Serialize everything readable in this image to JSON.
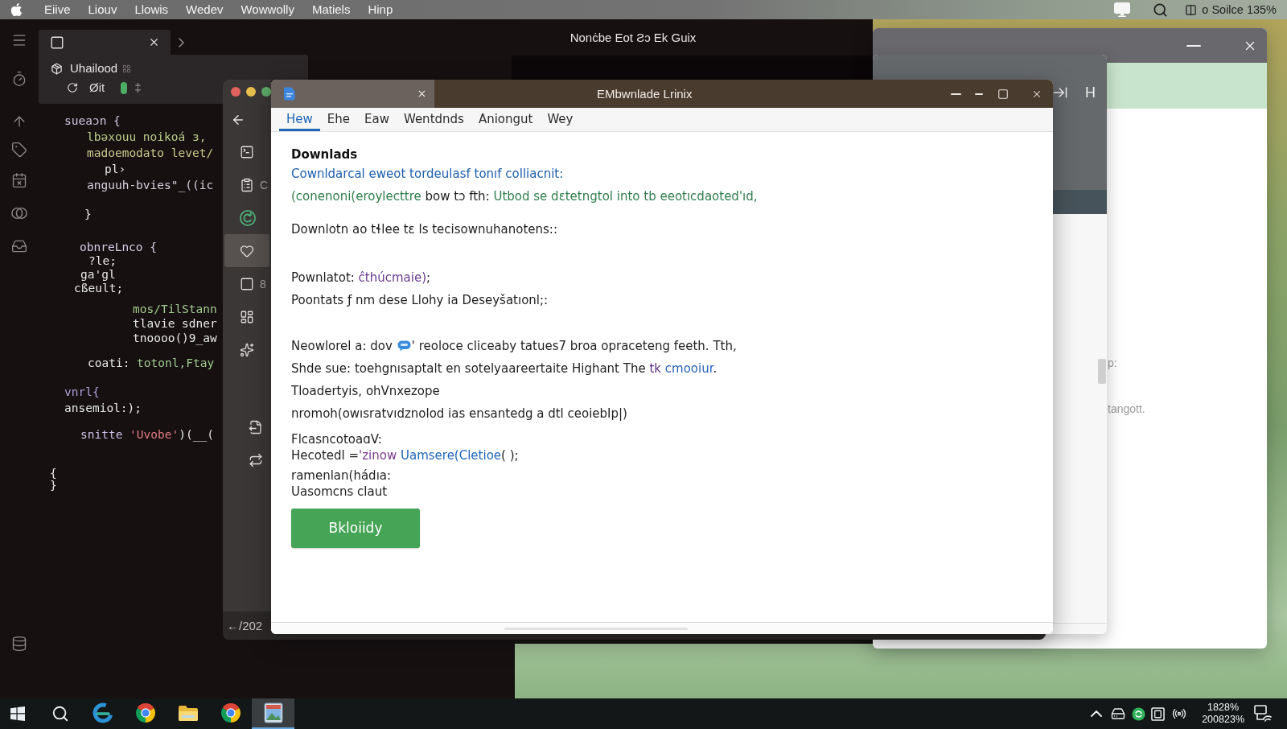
{
  "menu_bar": {
    "items": [
      "Eiive",
      "Liouv",
      "Llowis",
      "Wedev",
      "Wowwolly",
      "Matiels",
      "Hinp"
    ],
    "status_text": "o Soilce 135%"
  },
  "editor": {
    "tab_panel": {
      "title": "Uhailood",
      "branch": "Øit",
      "marker": "‡"
    },
    "code_blocks": [
      {
        "lines": [
          {
            "segments": [
              {
                "text": "sueaɔn {",
                "color": "#cdc8de"
              }
            ]
          },
          {
            "segments": [
              {
                "text": "lbəxouu noikoá ɜ,",
                "color": "#bccb8a"
              }
            ]
          },
          {
            "segments": [
              {
                "text": "madoemodato levet/",
                "color": "#c8c98c"
              }
            ]
          },
          {
            "segments": [
              {
                "text": "pl›",
                "color": "#e6e6e6"
              }
            ]
          },
          {
            "segments": [
              {
                "text": "anguuh-bvies\"_((ic",
                "color": "#d6d2dc"
              }
            ]
          }
        ]
      },
      {
        "lines": [
          {
            "segments": [
              {
                "text": "}",
                "color": "#e6e6e6"
              }
            ]
          }
        ]
      },
      {
        "lines": [
          {
            "segments": [
              {
                "text": "obnreLnco {",
                "color": "#d4cfe4"
              }
            ]
          },
          {
            "segments": [
              {
                "text": "?le;",
                "color": "#e6e6e6"
              }
            ]
          },
          {
            "segments": [
              {
                "text": "ga'gl",
                "color": "#e6e6e6"
              }
            ]
          },
          {
            "segments": [
              {
                "text": "cßeult;",
                "color": "#e6e6e6"
              }
            ]
          }
        ]
      },
      {
        "lines": [
          {
            "segments": [
              {
                "text": "mos/TilStann",
                "color": "#9fc98e"
              }
            ]
          },
          {
            "segments": [
              {
                "text": "tlavie sdner",
                "color": "#e6e6e6"
              }
            ]
          },
          {
            "segments": [
              {
                "text": "tnoooo()9_aw",
                "color": "#e6e6e6"
              }
            ]
          }
        ]
      },
      {
        "lines": [
          {
            "segments": [
              {
                "text": "coati: ",
                "color": "#e6e6e6"
              },
              {
                "text": "totonl,Ftay",
                "color": "#9fc98e"
              }
            ]
          }
        ]
      },
      {
        "lines": [
          {
            "segments": [
              {
                "text": "vnrl{",
                "color": "#aaa3d6"
              }
            ]
          },
          {
            "segments": [
              {
                "text": "ansemiol:);",
                "color": "#e6e6e6"
              }
            ]
          }
        ]
      },
      {
        "lines": [
          {
            "segments": [
              {
                "text": "snitte ",
                "color": "#c9c2e2"
              },
              {
                "text": "'Uvobe'",
                "color": "#e07b84"
              },
              {
                "text": ")(__(",
                "color": "#e6e6e6"
              }
            ]
          }
        ]
      },
      {
        "lines": [
          {
            "segments": [
              {
                "text": "{",
                "color": "#e6e6e6"
              }
            ]
          },
          {
            "segments": [
              {
                "text": "}",
                "color": "#e6e6e6"
              }
            ]
          }
        ]
      }
    ]
  },
  "dark_window": {
    "title": "Nonċbe Eot Ƨɔ Ek Guix"
  },
  "far_right_window": {
    "text_fragments": [
      "p:",
      "tangott."
    ]
  },
  "rear_window": {
    "toolbar_glyph": "H"
  },
  "side_window": {
    "sidebar_items": [
      {
        "selected": false
      },
      {
        "selected": false,
        "label": "C"
      },
      {
        "selected": false
      },
      {
        "selected": true
      },
      {
        "selected": false,
        "label": "8"
      },
      {
        "selected": false
      },
      {
        "selected": false
      },
      {
        "selected": false
      },
      {
        "selected": false
      }
    ],
    "footer_text": "←/202"
  },
  "main_window": {
    "title": "EMbwnlade Lrinix",
    "tabs": [
      {
        "label": "Hew",
        "selected": true
      },
      {
        "label": "Ehe",
        "selected": false
      },
      {
        "label": "Eaw",
        "selected": false
      },
      {
        "label": "Wentdnds",
        "selected": false
      },
      {
        "label": "Aniongut",
        "selected": false
      },
      {
        "label": "Wey",
        "selected": false
      }
    ],
    "content": {
      "heading": "Downlads",
      "paragraphs": [
        {
          "kind": "prose",
          "lines": [
            {
              "segments": [
                {
                  "text": "Cownldarcal eweot tordeulasf tonıf colliacnit:",
                  "color": "#1d5fae"
                }
              ]
            },
            {
              "segments": [
                {
                  "text": "(conenoni(eroylecttre",
                  "color": "#2f7d4a"
                },
                {
                  "text": " bow tɔ fth: "
                },
                {
                  "text": "Utbod se dɛtetngtol into tb eeotıcdaoted'ıd,",
                  "color": "#2f7d4a"
                }
              ]
            }
          ]
        },
        {
          "kind": "prose",
          "lines": [
            {
              "segments": [
                {
                  "text": "Downlotn ao tɬlee tɛ ls tecisownuhanotens::"
                }
              ]
            }
          ]
        },
        {
          "kind": "prose",
          "lines": [
            {
              "segments": [
                {
                  "text": "Pownlatot: "
                },
                {
                  "text": "ĉthúcmaie)",
                  "color": "#6a3d8f"
                },
                {
                  "text": ";"
                }
              ]
            },
            {
              "segments": [
                {
                  "text": "Poontats ƒ nm dese Llohy ia Deseyšatıonl;:"
                }
              ]
            }
          ]
        },
        {
          "kind": "prose",
          "lines": [
            {
              "segments": [
                {
                  "kind": "text",
                  "text": "Neowlorel a: dov"
                },
                {
                  "kind": "icon"
                },
                {
                  "kind": "text",
                  "text": "' reoloce cliceaby tatues7 broa opraceteng feeth. Tth,"
                }
              ]
            },
            {
              "segments": [
                {
                  "text": "Shde sue: toehgnısaptalt en sotelyaareertaite Highant The "
                },
                {
                  "text": "tk",
                  "color": "#5b2d86"
                },
                {
                  "text": " cmooiur",
                  "color": "#2a62b8"
                },
                {
                  "text": "."
                }
              ]
            },
            {
              "segments": [
                {
                  "text": "Tloadertyis, ohVnxezope"
                }
              ]
            },
            {
              "segments": [
                {
                  "text": "nromoh(owısratvıdznolod ias ensantedg a dtl ceoiebIp|)"
                }
              ]
            }
          ]
        },
        {
          "kind": "code",
          "lines": [
            {
              "segments": [
                {
                  "text": "FlcasncotoaɑV:"
                }
              ]
            },
            {
              "segments": [
                {
                  "text": "Hecotedl ="
                },
                {
                  "text": "'zinow",
                  "color": "#7a3a8f"
                },
                {
                  "text": " Uamsere(Cletioe",
                  "color": "#1f65b8"
                },
                {
                  "text": "( );"
                }
              ]
            }
          ]
        },
        {
          "kind": "code",
          "lines": [
            {
              "segments": [
                {
                  "text": "ramenlan(hádıa:"
                }
              ]
            },
            {
              "segments": [
                {
                  "text": "Uasomcns claut"
                }
              ]
            }
          ]
        }
      ],
      "button": "Bkloiidy"
    }
  },
  "taskbar": {
    "apps": [
      {
        "selected": false
      },
      {
        "selected": false
      },
      {
        "selected": false
      },
      {
        "selected": false
      },
      {
        "selected": true
      }
    ],
    "clock": {
      "time": "1828%",
      "date": "200823%"
    }
  }
}
